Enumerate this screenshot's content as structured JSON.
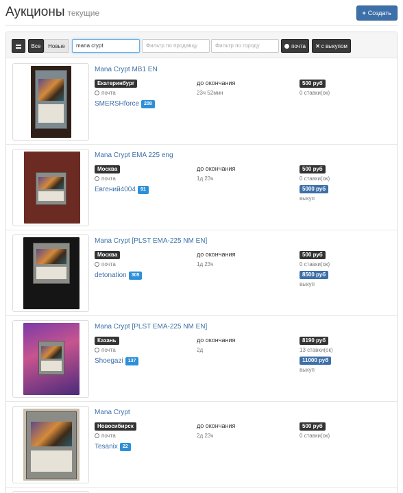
{
  "header": {
    "title": "Аукционы",
    "subtitle": "текущие",
    "create_label": "Создать"
  },
  "toolbar": {
    "all_label": "Все",
    "new_label": "Новые",
    "search_value": "mana crypt",
    "seller_placeholder": "Фильтр по продавцу",
    "city_placeholder": "Фильтр по городу",
    "mail_label": "почта",
    "buyout_label": "с выкупом"
  },
  "lots": [
    {
      "title": "Mana Crypt MB1 EN",
      "city": "Екатеринбург",
      "delivery": "почта",
      "seller": "SMERSHforce",
      "rating": "208",
      "ends_label": "до окончания",
      "time_left": "23ч 52мин",
      "price": "500 руб",
      "bids": "0 ставки(ок)",
      "buyout_price": "",
      "buyout_label": ""
    },
    {
      "title": "Mana Crypt EMA 225 eng",
      "city": "Москва",
      "delivery": "почта",
      "seller": "Евгений4004",
      "rating": "91",
      "ends_label": "до окончания",
      "time_left": "1д 23ч",
      "price": "500 руб",
      "bids": "0 ставки(ок)",
      "buyout_price": "5000 руб",
      "buyout_label": "выкуп"
    },
    {
      "title": "Mana Crypt [PLST EMA-225 NM EN]",
      "city": "Москва",
      "delivery": "почта",
      "seller": "detonation",
      "rating": "305",
      "ends_label": "до окончания",
      "time_left": "1д 23ч",
      "price": "500 руб",
      "bids": "0 ставки(ок)",
      "buyout_price": "8500 руб",
      "buyout_label": "выкуп"
    },
    {
      "title": "Mana Crypt [PLST EMA-225 NM EN]",
      "city": "Казань",
      "delivery": "почта",
      "seller": "Shoegazi",
      "rating": "137",
      "ends_label": "до окончания",
      "time_left": "2д",
      "price": "8190 руб",
      "bids": "13 ставки(ок)",
      "buyout_price": "11000 руб",
      "buyout_label": "выкуп"
    },
    {
      "title": "Mana Crypt",
      "city": "Новосибирск",
      "delivery": "почта",
      "seller": "Tesanix",
      "rating": "22",
      "ends_label": "до окончания",
      "time_left": "2д 23ч",
      "price": "500 руб",
      "bids": "0 ставки(ок)",
      "buyout_price": "",
      "buyout_label": ""
    }
  ]
}
